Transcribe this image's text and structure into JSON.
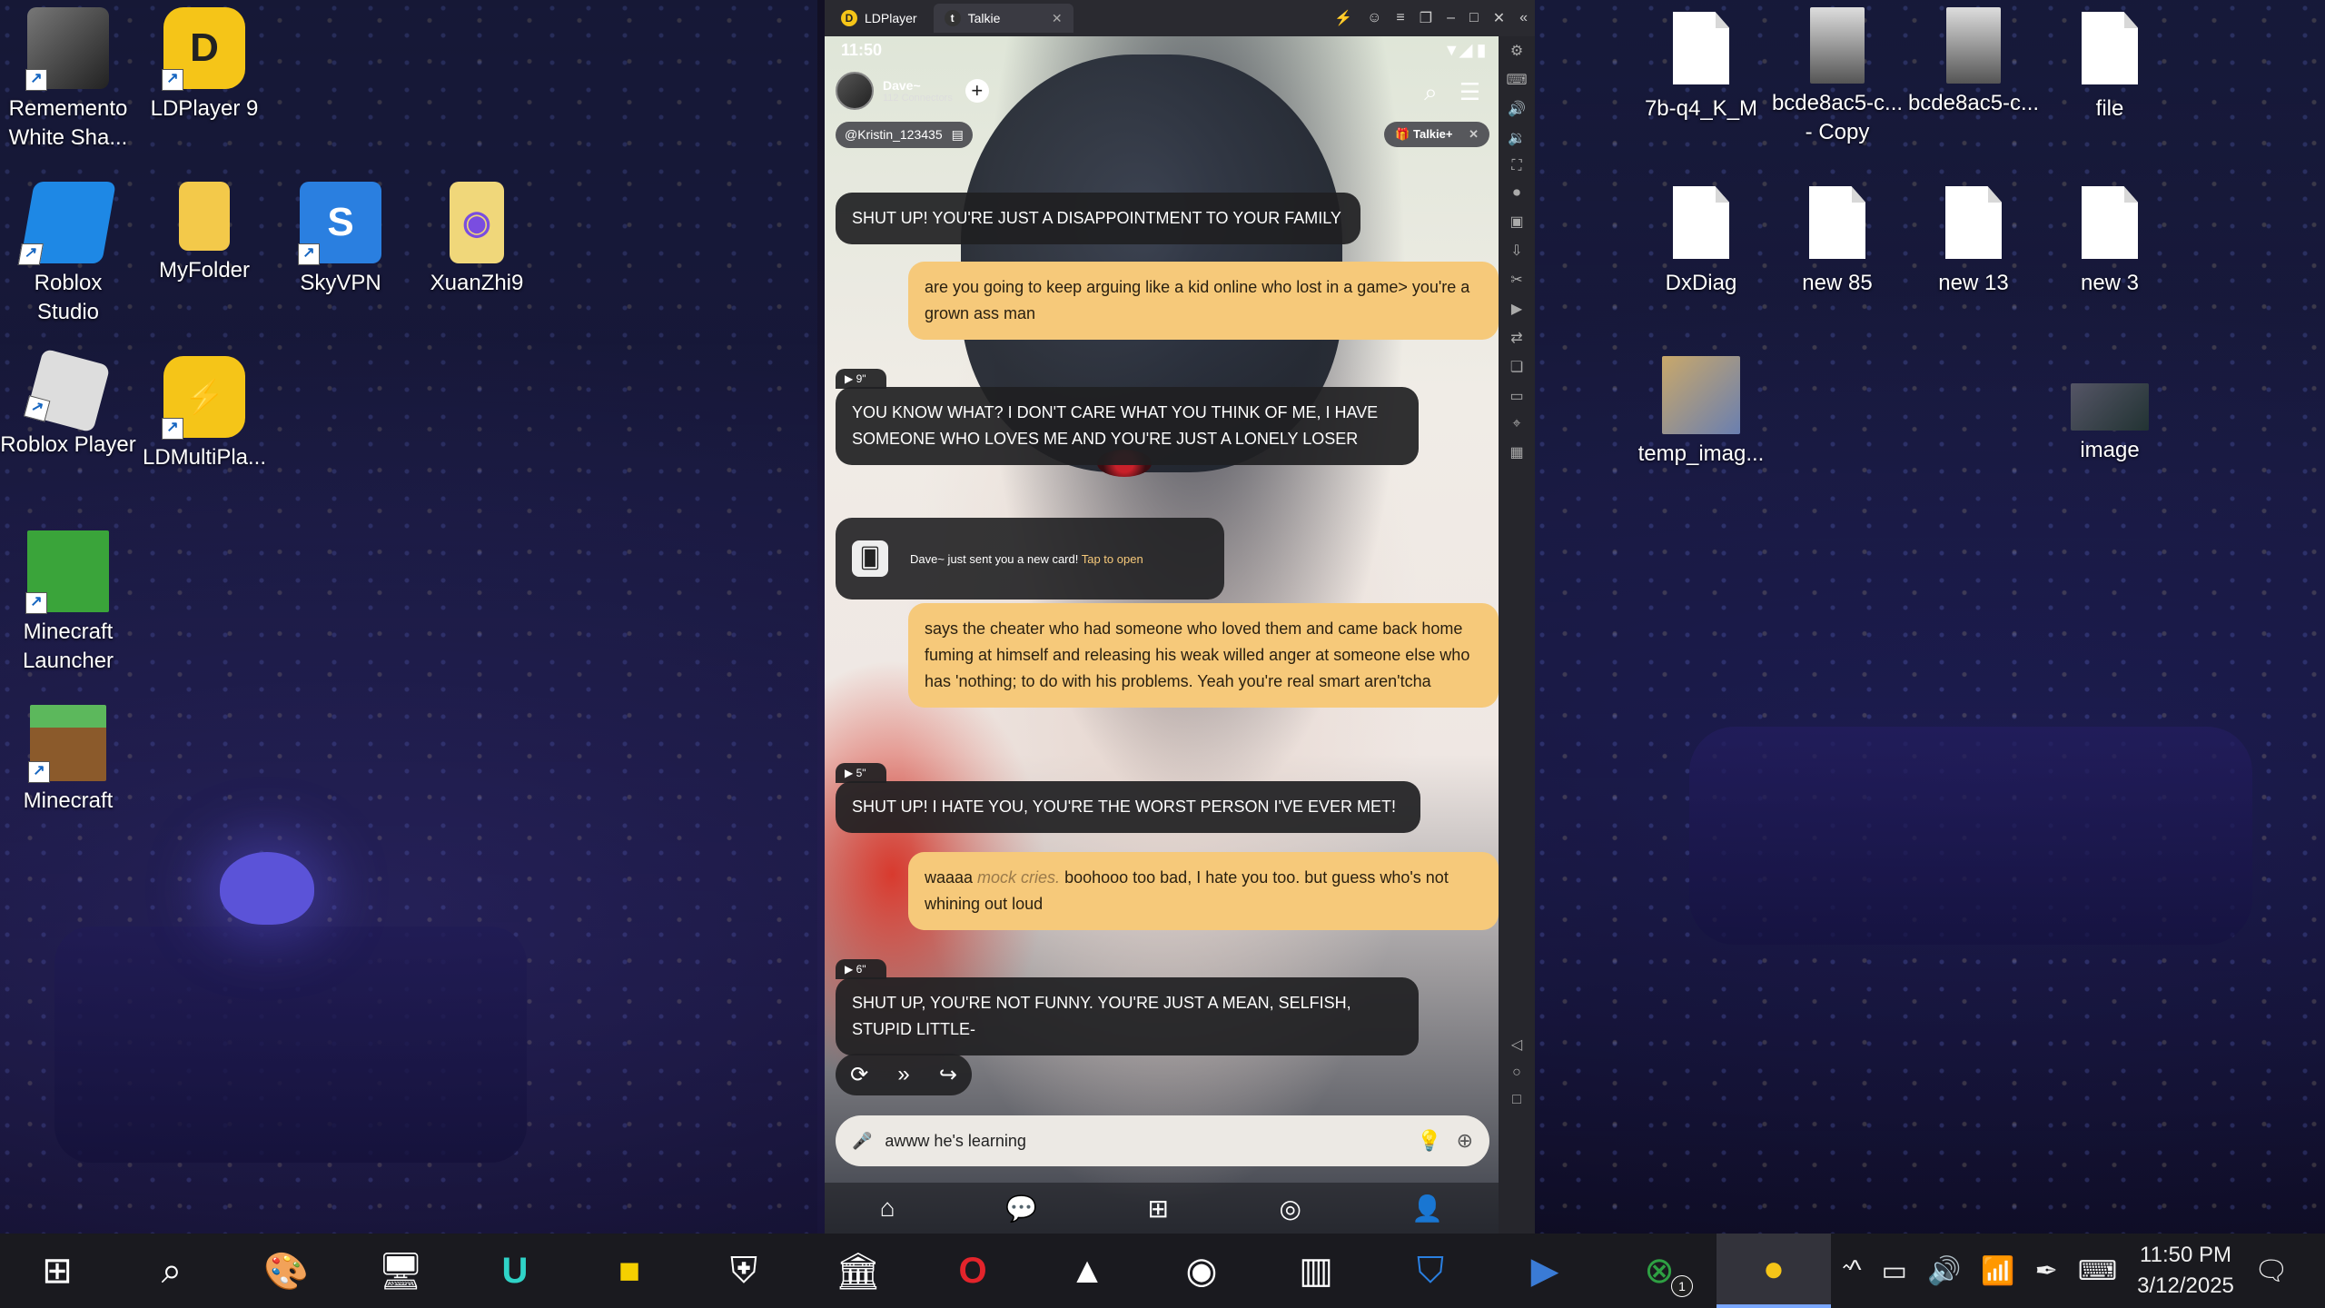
{
  "desktop": {
    "left_icons": [
      {
        "label": "Rememento\nWhite Sha...",
        "icon": "rememento-icon"
      },
      {
        "label": "LDPlayer 9",
        "icon": "ldplayer-icon"
      },
      {
        "label": "Roblox\nStudio",
        "icon": "roblox-studio-icon"
      },
      {
        "label": "MyFolder",
        "icon": "folder-icon"
      },
      {
        "label": "SkyVPN",
        "icon": "skyvpn-icon"
      },
      {
        "label": "XuanZhi9",
        "icon": "xuanzhi-icon"
      },
      {
        "label": "Roblox Player",
        "icon": "roblox-icon"
      },
      {
        "label": "LDMultiPla...",
        "icon": "ldmultiplayer-icon"
      },
      {
        "label": "Minecraft\nLauncher",
        "icon": "minecraft-launcher-icon"
      },
      {
        "label": "Minecraft",
        "icon": "minecraft-icon"
      }
    ],
    "right_icons": [
      {
        "label": "7b-q4_K_M"
      },
      {
        "label": "bcde8ac5-c...\n- Copy"
      },
      {
        "label": "bcde8ac5-c..."
      },
      {
        "label": "file"
      },
      {
        "label": "DxDiag"
      },
      {
        "label": "new 85"
      },
      {
        "label": "new 13"
      },
      {
        "label": "new 3"
      },
      {
        "label": "temp_imag..."
      },
      {
        "label": "image"
      }
    ]
  },
  "emulator": {
    "tabs": [
      {
        "label": "LDPlayer"
      },
      {
        "label": "Talkie"
      }
    ],
    "status_time": "11:50",
    "character_name": "Dave~",
    "connectors": "112 Connectors",
    "user_handle": "@Kristin_123435",
    "talkie_plus": "Talkie+",
    "messages": [
      {
        "type": "bot",
        "text": "SHUT UP! YOU'RE JUST A DISAPPOINTMENT TO YOUR FAMILY"
      },
      {
        "type": "user",
        "text": "are you going to keep arguing like a kid online who lost in a game> you're a grown ass man"
      },
      {
        "type": "bot",
        "audio": "9\"",
        "text": "YOU KNOW WHAT? I DON'T CARE WHAT YOU THINK OF ME, I HAVE SOMEONE WHO LOVES ME AND YOU'RE JUST A LONELY LOSER"
      },
      {
        "type": "user",
        "text": "says the cheater who had someone who loved them and came back home fuming at himself and releasing his weak willed anger at someone else who has 'nothing; to do with his problems. Yeah you're real smart aren'tcha"
      },
      {
        "type": "bot",
        "audio": "5\"",
        "text": "SHUT UP! I HATE YOU, YOU'RE THE WORST PERSON I'VE EVER MET!"
      },
      {
        "type": "user",
        "prefix": "waaaa ",
        "italic": "mock cries.",
        "text": " boohooo too bad, I hate you too. but guess who's not whining out loud"
      },
      {
        "type": "bot",
        "audio": "6\"",
        "text": "SHUT UP, YOU'RE NOT FUNNY. YOU'RE JUST A MEAN, SELFISH, STUPID LITTLE-"
      }
    ],
    "card": {
      "text": "Dave~ just sent you a new card! ",
      "tap": "Tap to open"
    },
    "input_value": "awww he's learning"
  },
  "taskbar": {
    "clock_time": "11:50 PM",
    "clock_date": "3/12/2025",
    "xbox_badge": "1"
  }
}
